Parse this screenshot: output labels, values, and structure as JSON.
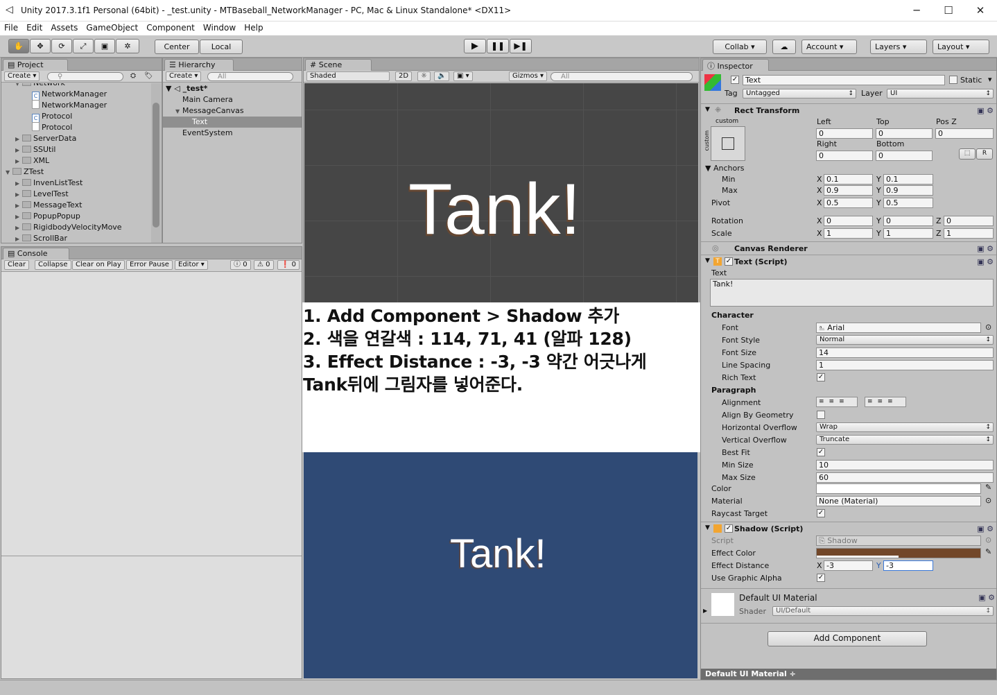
{
  "window": {
    "title": "Unity 2017.3.1f1 Personal (64bit) - _test.unity - MTBaseball_NetworkManager - PC, Mac & Linux Standalone* <DX11>",
    "minimize": "─",
    "maximize": "☐",
    "close": "✕"
  },
  "menu": [
    "File",
    "Edit",
    "Assets",
    "GameObject",
    "Component",
    "Window",
    "Help"
  ],
  "toolbar": {
    "center": "Center",
    "local": "Local",
    "collab": "Collab ▾",
    "account": "Account",
    "layers": "Layers",
    "layout": "Layout"
  },
  "project": {
    "tab": "Project",
    "create": "Create ▾",
    "items": [
      {
        "label": "Network",
        "icon": "folder",
        "depth": 1,
        "arrow": "▼"
      },
      {
        "label": "NetworkManager",
        "icon": "cs",
        "depth": 2,
        "arrow": ""
      },
      {
        "label": "NetworkManager",
        "icon": "file",
        "depth": 2,
        "arrow": ""
      },
      {
        "label": "Protocol",
        "icon": "cs",
        "depth": 2,
        "arrow": ""
      },
      {
        "label": "Protocol",
        "icon": "file",
        "depth": 2,
        "arrow": ""
      },
      {
        "label": "ServerData",
        "icon": "folder",
        "depth": 1,
        "arrow": "▶"
      },
      {
        "label": "SSUtil",
        "icon": "folder",
        "depth": 1,
        "arrow": "▶"
      },
      {
        "label": "XML",
        "icon": "folder",
        "depth": 1,
        "arrow": "▶"
      },
      {
        "label": "ZTest",
        "icon": "folder",
        "depth": 0,
        "arrow": "▼"
      },
      {
        "label": "InvenListTest",
        "icon": "folder",
        "depth": 1,
        "arrow": "▶"
      },
      {
        "label": "LevelTest",
        "icon": "folder",
        "depth": 1,
        "arrow": "▶"
      },
      {
        "label": "MessageText",
        "icon": "folder",
        "depth": 1,
        "arrow": "▶"
      },
      {
        "label": "PopupPopup",
        "icon": "folder",
        "depth": 1,
        "arrow": "▶"
      },
      {
        "label": "RigidbodyVelocityMove",
        "icon": "folder",
        "depth": 1,
        "arrow": "▶"
      },
      {
        "label": "ScrollBar",
        "icon": "folder",
        "depth": 1,
        "arrow": "▶"
      }
    ]
  },
  "hierarchy": {
    "tab": "Hierarchy",
    "create": "Create ▾",
    "search": "All",
    "scene": "_test*",
    "items": [
      {
        "label": "Main Camera",
        "depth": 1,
        "arrow": "",
        "selected": false
      },
      {
        "label": "MessageCanvas",
        "depth": 1,
        "arrow": "▼",
        "selected": false
      },
      {
        "label": "Text",
        "depth": 2,
        "arrow": "",
        "selected": true
      },
      {
        "label": "EventSystem",
        "depth": 1,
        "arrow": "",
        "selected": false
      }
    ]
  },
  "console": {
    "tab": "Console",
    "buttons": [
      "Clear",
      "Collapse",
      "Clear on Play",
      "Error Pause",
      "Editor ▾"
    ],
    "counts": [
      "0",
      "0",
      "0"
    ]
  },
  "scene": {
    "tab": "Scene",
    "shaded": "Shaded",
    "mode2d": "2D",
    "gizmos": "Gizmos ▾",
    "search": "All",
    "text": "Tank!"
  },
  "overlay": {
    "lines": [
      "1. Add Component > Shadow 추가",
      "2. 색을 연갈색 :  114, 71, 41 (알파 128)",
      "3. Effect Distance : -3, -3 약간 어긋나게",
      "Tank뒤에 그림자를 넣어준다."
    ]
  },
  "game": {
    "text": "Tank!"
  },
  "inspector": {
    "tab": "Inspector",
    "name": "Text",
    "static": "Static",
    "tag_label": "Tag",
    "tag": "Untagged",
    "layer_label": "Layer",
    "layer": "UI",
    "rect": {
      "title": "Rect Transform",
      "anchor_preset": "custom",
      "left_label": "Left",
      "top_label": "Top",
      "posz_label": "Pos Z",
      "left": "0",
      "top": "0",
      "posz": "0",
      "right_label": "Right",
      "bottom_label": "Bottom",
      "right": "0",
      "bottom": "0",
      "anchors": "Anchors",
      "min": "Min",
      "max": "Max",
      "pivot": "Pivot",
      "min_x": "0.1",
      "min_y": "0.1",
      "max_x": "0.9",
      "max_y": "0.9",
      "pivot_x": "0.5",
      "pivot_y": "0.5",
      "rotation": "Rotation",
      "rot_x": "0",
      "rot_y": "0",
      "rot_z": "0",
      "scale": "Scale",
      "scale_x": "1",
      "scale_y": "1",
      "scale_z": "1"
    },
    "canvas_renderer": "Canvas Renderer",
    "text_script": {
      "title": "Text (Script)",
      "text_label": "Text",
      "text": "Tank!",
      "character": "Character",
      "font_label": "Font",
      "font": "Arial",
      "font_style_label": "Font Style",
      "font_style": "Normal",
      "font_size_label": "Font Size",
      "font_size": "14",
      "line_spacing_label": "Line Spacing",
      "line_spacing": "1",
      "rich_text_label": "Rich Text",
      "paragraph": "Paragraph",
      "alignment_label": "Alignment",
      "align_geom_label": "Align By Geometry",
      "hover_label": "Horizontal Overflow",
      "hover": "Wrap",
      "vover_label": "Vertical Overflow",
      "vover": "Truncate",
      "best_fit_label": "Best Fit",
      "min_size_label": "Min Size",
      "min_size": "10",
      "max_size_label": "Max Size",
      "max_size": "60",
      "color_label": "Color",
      "material_label": "Material",
      "material": "None (Material)",
      "raycast_label": "Raycast Target"
    },
    "shadow": {
      "title": "Shadow (Script)",
      "script_label": "Script",
      "script": "Shadow",
      "effect_color_label": "Effect Color",
      "effect_color": "#724729",
      "effect_distance_label": "Effect Distance",
      "dist_x": "-3",
      "dist_y": "-3",
      "use_alpha_label": "Use Graphic Alpha"
    },
    "material": {
      "name": "Default UI Material",
      "shader_label": "Shader",
      "shader": "UI/Default"
    },
    "add_component": "Add Component",
    "footer": "Default UI Material ÷"
  }
}
